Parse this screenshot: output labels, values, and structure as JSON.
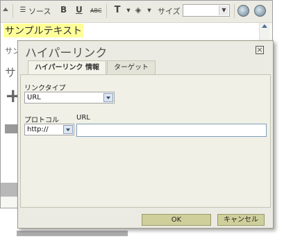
{
  "toolbar": {
    "source_label": "ソース",
    "bold_label": "B",
    "underline_label": "U",
    "strike_label": "ABC",
    "textcolor_label": "T",
    "bgcolor_label": "◈",
    "size_label": "サイズ",
    "size_value": ""
  },
  "editor": {
    "highlight_text": "サンプルテキスト",
    "line1_text": "サン",
    "line2_text": "サ",
    "plus_text": "+"
  },
  "dialog": {
    "title": "ハイパーリンク",
    "close_glyph": "×",
    "tabs": [
      {
        "label": "ハイパーリンク 情報"
      },
      {
        "label": "ターゲット"
      }
    ],
    "link_type_label": "リンクタイプ",
    "link_type_value": "URL",
    "protocol_label": "プロトコル",
    "protocol_value": "http://",
    "url_label": "URL",
    "url_value": "",
    "ok_label": "OK",
    "cancel_label": "キャンセル"
  },
  "colors": {
    "highlight": "#ffff99",
    "dialog_bg": "#ebebe3",
    "button_bg": "#cfcf9c"
  }
}
